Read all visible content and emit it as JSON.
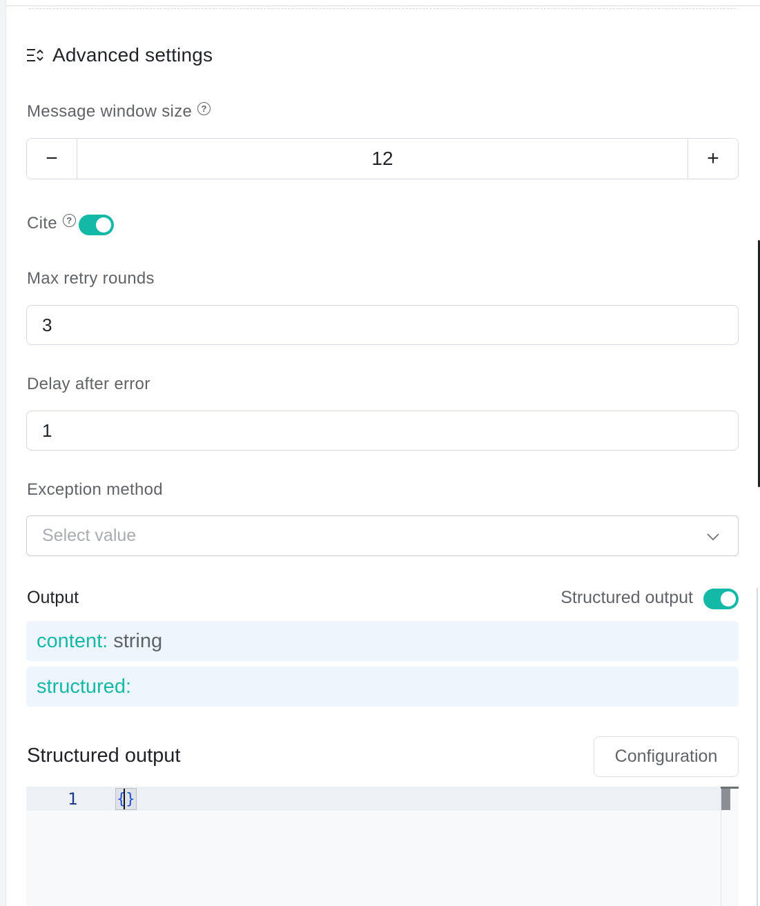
{
  "section": {
    "title": "Advanced settings",
    "icon": "list-settings-icon"
  },
  "message_window": {
    "label": "Message window size",
    "value": "12",
    "minus": "−",
    "plus": "+"
  },
  "cite": {
    "label": "Cite",
    "enabled": true
  },
  "max_retry": {
    "label": "Max retry rounds",
    "value": "3"
  },
  "delay": {
    "label": "Delay after error",
    "value": "1"
  },
  "exception": {
    "label": "Exception method",
    "placeholder": "Select value"
  },
  "output": {
    "label": "Output",
    "structured_toggle_label": "Structured output",
    "structured_enabled": true,
    "rows": [
      {
        "key": "content:",
        "type": "string"
      },
      {
        "key": "structured:",
        "type": ""
      }
    ]
  },
  "structured_output": {
    "title": "Structured output",
    "config_button": "Configuration",
    "editor": {
      "line_number": "1",
      "code": "{}"
    }
  },
  "colors": {
    "accent": "#14b8a6",
    "output_row_bg": "#eef5fc"
  }
}
